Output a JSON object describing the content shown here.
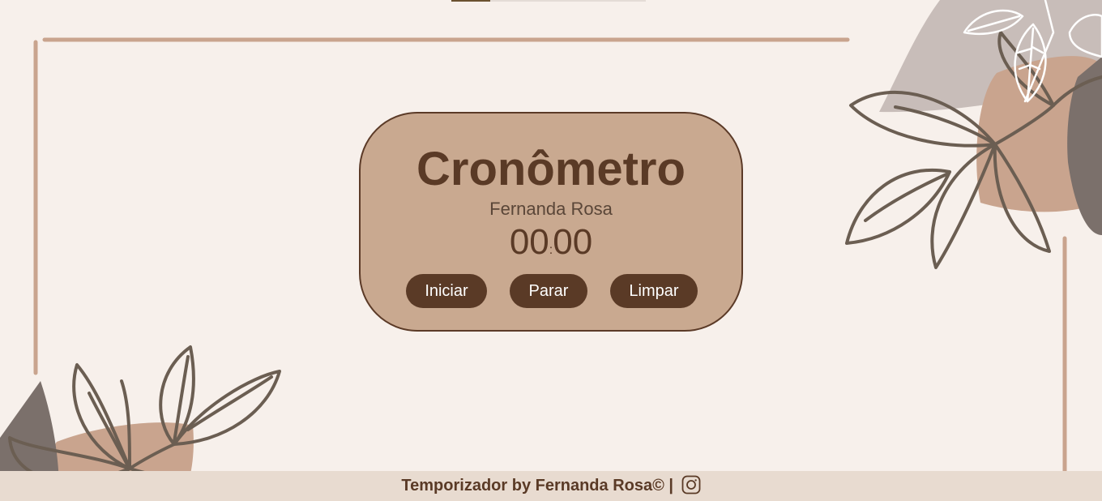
{
  "card": {
    "title": "Cronômetro",
    "subtitle": "Fernanda Rosa",
    "timer": {
      "minutes": "00",
      "separator": ":",
      "seconds": "00"
    },
    "buttons": {
      "start": "Iniciar",
      "stop": "Parar",
      "clear": "Limpar"
    }
  },
  "footer": {
    "text": "Temporizador by Fernanda Rosa© |",
    "icon": "instagram-icon"
  },
  "colors": {
    "background": "#f7f0eb",
    "card": "#c9a990",
    "accent_dark": "#5a3a26",
    "frame_line": "#c9a48e",
    "footer_bg": "#e8dbd0"
  }
}
